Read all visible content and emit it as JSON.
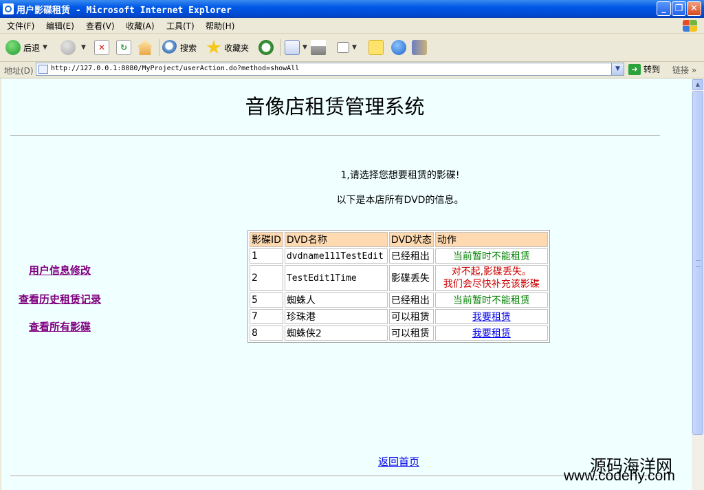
{
  "window": {
    "title": "用户影碟租赁 - Microsoft Internet Explorer",
    "min_label": "_",
    "max_label": "❐",
    "close_label": "✕"
  },
  "menu": [
    "文件(F)",
    "编辑(E)",
    "查看(V)",
    "收藏(A)",
    "工具(T)",
    "帮助(H)"
  ],
  "toolbar": {
    "back_label": "后退",
    "search_label": "搜索",
    "favorites_label": "收藏夹"
  },
  "address": {
    "label": "地址(D)",
    "url": "http://127.0.0.1:8080/MyProject/userAction.do?method=showAll",
    "go_label": "转到",
    "links_label": "链接"
  },
  "page": {
    "title": "音像店租赁管理系统",
    "message1": "1,请选择您想要租赁的影碟!",
    "message2": "以下是本店所有DVD的信息。",
    "sidebar": [
      "用户信息修改",
      "查看历史租赁记录",
      "查看所有影碟"
    ],
    "back_home": "返回首页"
  },
  "table": {
    "headers": [
      "影碟ID",
      "DVD名称",
      "DVD状态",
      "动作"
    ],
    "rows": [
      {
        "id": "1",
        "name": "dvdname111TestEdit",
        "status": "已经租出",
        "action": "当前暂时不能租赁",
        "type": "unavailable"
      },
      {
        "id": "2",
        "name": "TestEdit1Time",
        "status": "影碟丢失",
        "action": "对不起,影碟丢失。",
        "action2": "我们会尽快补充该影碟",
        "type": "lost"
      },
      {
        "id": "5",
        "name": "蜘蛛人",
        "status": "已经租出",
        "action": "当前暂时不能租赁",
        "type": "unavailable"
      },
      {
        "id": "7",
        "name": "珍珠港",
        "status": "可以租赁",
        "action": "我要租赁",
        "type": "rent"
      },
      {
        "id": "8",
        "name": "蜘蛛侠2",
        "status": "可以租赁",
        "action": "我要租赁",
        "type": "rent"
      }
    ]
  },
  "watermark": {
    "line1": "源码海洋网",
    "line2": "www.codehy.com"
  },
  "colors": {
    "page_bg": "#f0ffff",
    "header_bg": "#ffdab0",
    "unavailable": "#008000",
    "lost": "#cc0000",
    "link": "#0000ee",
    "visited": "#800080"
  }
}
